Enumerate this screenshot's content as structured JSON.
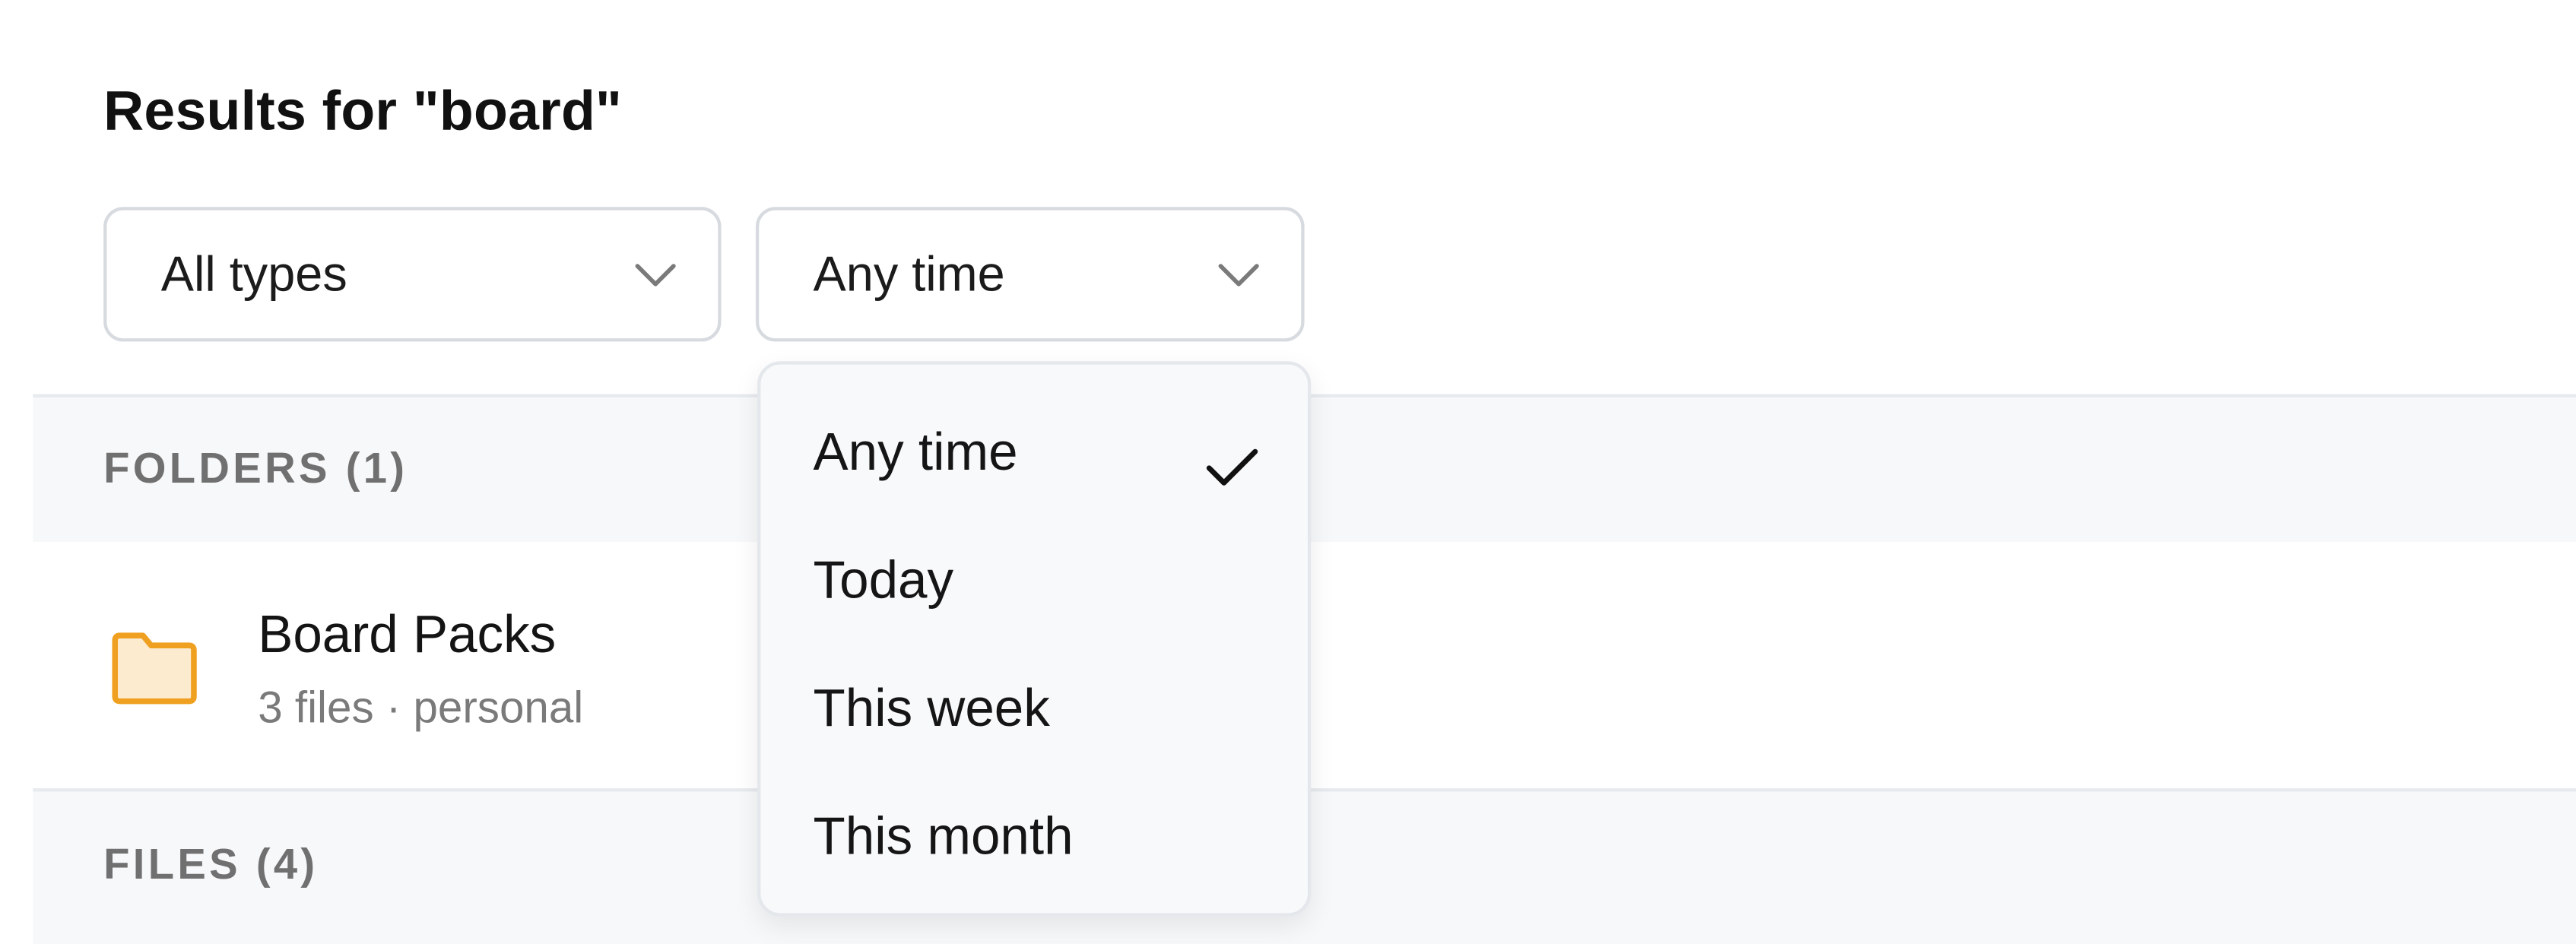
{
  "header": {
    "title": "Results for \"board\""
  },
  "filters": {
    "type": {
      "selected": "All types",
      "icon": "chevron-down-icon"
    },
    "time": {
      "selected": "Any time",
      "icon": "chevron-down-icon"
    }
  },
  "sections": {
    "folders": {
      "label": "FOLDERS (1)"
    },
    "files": {
      "label": "FILES (4)"
    }
  },
  "folders": [
    {
      "name": "Board Packs",
      "meta": "3 files · personal",
      "icon": "folder-icon",
      "icon_color": "#F0A020"
    }
  ],
  "time_menu": {
    "options": [
      "Any time",
      "Today",
      "This week",
      "This month"
    ],
    "selected": "Any time",
    "selected_icon": "check-icon"
  },
  "colors": {
    "folder_accent": "#F0A020",
    "folder_fill": "#FDEBD0",
    "section_bg": "#F7F8FA",
    "muted_text": "#707070"
  }
}
